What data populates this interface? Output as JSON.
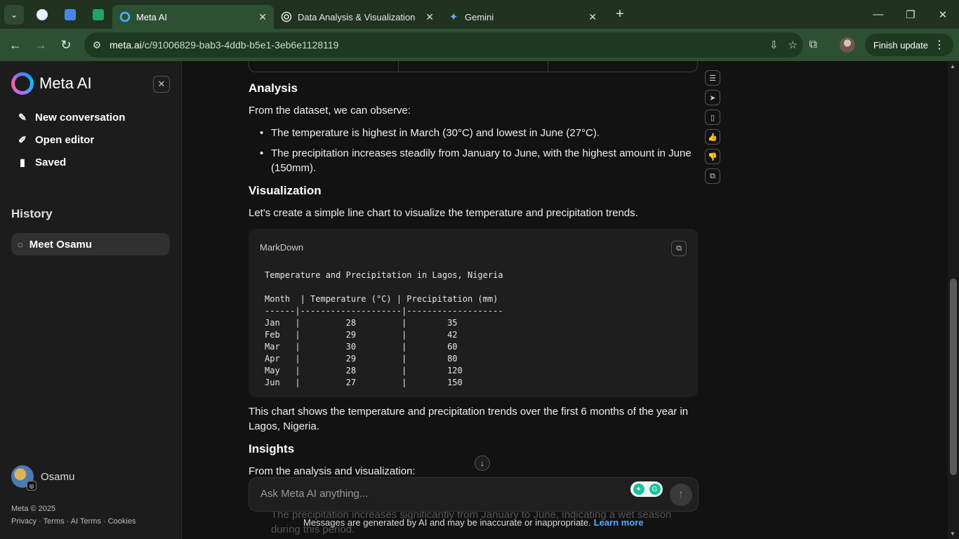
{
  "browser": {
    "tabs": [
      {
        "label": "Meta AI",
        "active": true
      },
      {
        "label": "Data Analysis & Visualization",
        "active": false
      },
      {
        "label": "Gemini",
        "active": false
      }
    ],
    "url_domain": "meta.ai",
    "url_path": "/c/91006829-bab3-4ddb-b5e1-3eb6e1128119",
    "finish_update": "Finish update"
  },
  "sidebar": {
    "logo_text": "Meta AI",
    "items": [
      {
        "label": "New conversation",
        "icon": "edit-icon"
      },
      {
        "label": "Open editor",
        "icon": "pen-icon"
      },
      {
        "label": "Saved",
        "icon": "bookmark-icon"
      }
    ],
    "history_title": "History",
    "history_items": [
      {
        "label": "Meet Osamu"
      }
    ],
    "user_name": "Osamu",
    "footer_copyright": "Meta © 2025",
    "footer_links": "Privacy · Terms · AI Terms · Cookies"
  },
  "chat": {
    "analysis_title": "Analysis",
    "analysis_intro": "From the dataset, we can observe:",
    "analysis_bullets": [
      "The temperature is highest in March (30°C) and lowest in June (27°C).",
      "The precipitation increases steadily from January to June, with the highest amount in June (150mm)."
    ],
    "visualization_title": "Visualization",
    "visualization_intro": "Let's create a simple line chart to visualize the temperature and precipitation trends.",
    "code_language": "MarkDown",
    "code_text": "Temperature and Precipitation in Lagos, Nigeria\n\nMonth  | Temperature (°C) | Precipitation (mm)\n------|--------------------|-------------------\nJan   |         28         |        35\nFeb   |         29         |        42\nMar   |         30         |        60\nApr   |         29         |        80\nMay   |         28         |        120\nJun   |         27         |        150",
    "chart_summary": "This chart shows the temperature and precipitation trends over the first 6 months of the year in Lagos, Nigeria.",
    "insights_title": "Insights",
    "insights_intro": "From the analysis and visualization:",
    "ghost_text": "The precipitation increases significantly from January to June, indicating a wet season during this period."
  },
  "composer": {
    "placeholder": "Ask Meta AI anything...",
    "disclaimer": "Messages are generated by AI and may be inaccurate or inappropriate.",
    "learn_more": "Learn more"
  }
}
